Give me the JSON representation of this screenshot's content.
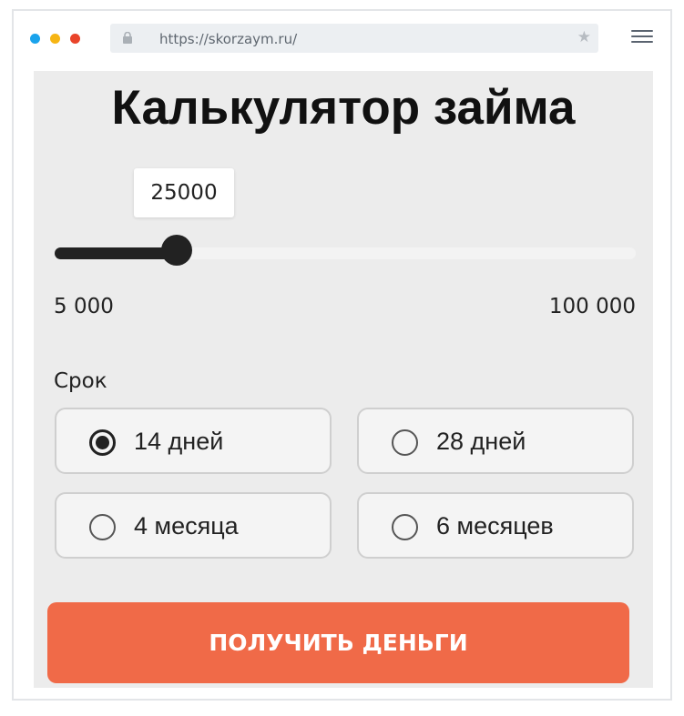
{
  "browser": {
    "url": "https://skorzaym.ru/",
    "window_controls": [
      "close-dot",
      "minimize-dot",
      "maximize-dot"
    ]
  },
  "calculator": {
    "title": "Калькулятор займа",
    "amount": {
      "value": "25000",
      "value_number": 25000,
      "min_label": "5 000",
      "max_label": "100 000",
      "min": 5000,
      "max": 100000
    },
    "term": {
      "label": "Срок",
      "options": [
        {
          "label": "14 дней",
          "selected": true
        },
        {
          "label": "28 дней",
          "selected": false
        },
        {
          "label": "4 месяца",
          "selected": false
        },
        {
          "label": "6 месяцев",
          "selected": false
        }
      ]
    },
    "submit_label": "ПОЛУЧИТЬ ДЕНЬГИ"
  },
  "colors": {
    "accent": "#f06a48",
    "slider": "#222222",
    "panel_bg": "#ececec"
  }
}
